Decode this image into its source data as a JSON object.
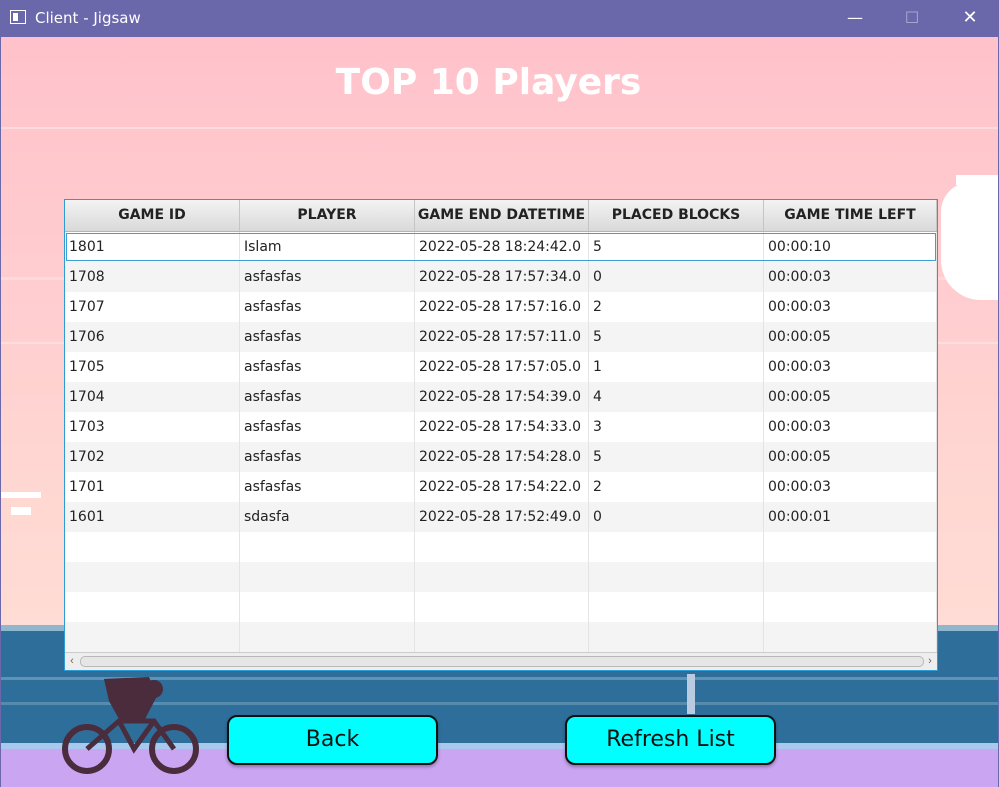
{
  "window": {
    "title": "Client - Jigsaw",
    "minimize_glyph": "—",
    "maximize_glyph": "☐",
    "close_glyph": "✕",
    "accent": "#6a67ab"
  },
  "heading": "TOP 10 Players",
  "table": {
    "columns": [
      "GAME ID",
      "PLAYER",
      "GAME END DATETIME",
      "PLACED BLOCKS",
      "GAME TIME LEFT"
    ],
    "rows": [
      [
        "1801",
        "Islam",
        "2022-05-28 18:24:42.0",
        "5",
        "00:00:10"
      ],
      [
        "1708",
        "asfasfas",
        "2022-05-28 17:57:34.0",
        "0",
        "00:00:03"
      ],
      [
        "1707",
        "asfasfas",
        "2022-05-28 17:57:16.0",
        "2",
        "00:00:03"
      ],
      [
        "1706",
        "asfasfas",
        "2022-05-28 17:57:11.0",
        "5",
        "00:00:05"
      ],
      [
        "1705",
        "asfasfas",
        "2022-05-28 17:57:05.0",
        "1",
        "00:00:03"
      ],
      [
        "1704",
        "asfasfas",
        "2022-05-28 17:54:39.0",
        "4",
        "00:00:05"
      ],
      [
        "1703",
        "asfasfas",
        "2022-05-28 17:54:33.0",
        "3",
        "00:00:03"
      ],
      [
        "1702",
        "asfasfas",
        "2022-05-28 17:54:28.0",
        "5",
        "00:00:05"
      ],
      [
        "1701",
        "asfasfas",
        "2022-05-28 17:54:22.0",
        "2",
        "00:00:03"
      ],
      [
        "1601",
        "sdasfa",
        "2022-05-28 17:52:49.0",
        "0",
        "00:00:01"
      ]
    ],
    "empty_rows": 4,
    "selected_row": 0,
    "scroll_left_glyph": "‹",
    "scroll_right_glyph": "›"
  },
  "buttons": {
    "back": "Back",
    "refresh": "Refresh List",
    "color": "#00ffff"
  }
}
